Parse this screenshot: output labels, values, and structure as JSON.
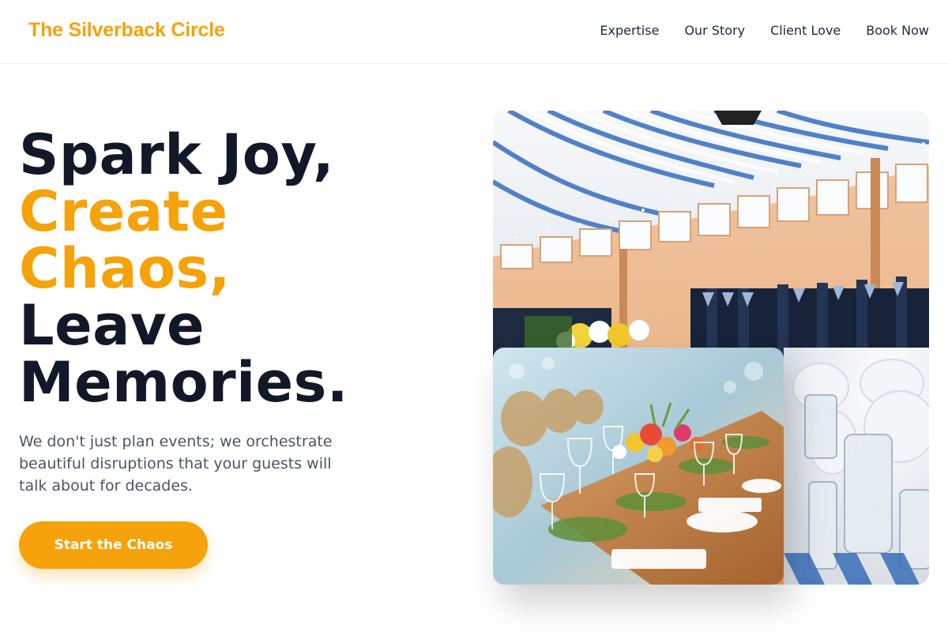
{
  "brand": {
    "name": "The Silverback Circle"
  },
  "nav": {
    "items": [
      {
        "label": "Expertise"
      },
      {
        "label": "Our Story"
      },
      {
        "label": "Client Love"
      },
      {
        "label": "Book Now"
      }
    ]
  },
  "hero": {
    "headline": {
      "line1": "Spark Joy,",
      "line2": "Create",
      "line3": "Chaos,",
      "line4": "Leave",
      "line5": "Memories."
    },
    "subtext": "We don't just plan events; we orchestrate beautiful disruptions that your guests will talk about for decades.",
    "cta_label": "Start the Chaos"
  },
  "colors": {
    "accent": "#f5a20b",
    "heading": "#111827",
    "body_text": "#4b5563"
  }
}
